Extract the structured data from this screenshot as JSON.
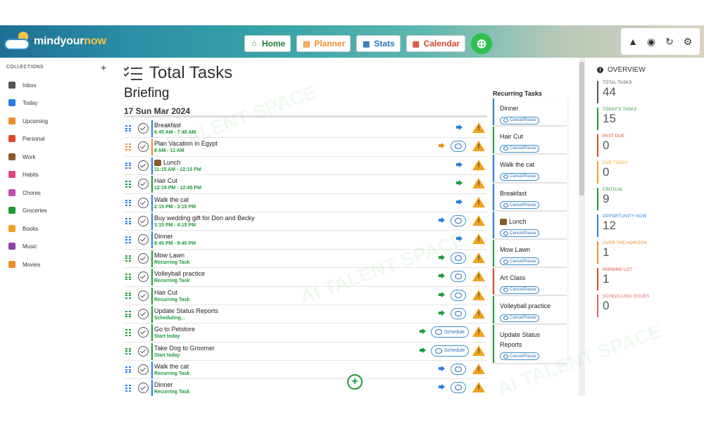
{
  "header": {
    "logo_text_1": "mindyour",
    "logo_text_2": "now",
    "nav": {
      "home": "Home",
      "planner": "Planner",
      "stats": "Stats",
      "calendar": "Calendar"
    }
  },
  "sidebar": {
    "heading": "COLLECTIONS",
    "items": [
      {
        "label": "Inbox",
        "color": "#555555"
      },
      {
        "label": "Today",
        "color": "#2a7de1"
      },
      {
        "label": "Upcoming",
        "color": "#f08c2a"
      },
      {
        "label": "Personal",
        "color": "#d9482b"
      },
      {
        "label": "Work",
        "color": "#8a5a2b"
      },
      {
        "label": "Habits",
        "color": "#e0457b"
      },
      {
        "label": "Chores",
        "color": "#c44bb0"
      },
      {
        "label": "Groceries",
        "color": "#1e9a3a"
      },
      {
        "label": "Books",
        "color": "#f2a11f"
      },
      {
        "label": "Music",
        "color": "#8e44ad"
      },
      {
        "label": "Movies",
        "color": "#f08c2a"
      }
    ]
  },
  "main": {
    "title": "Total Tasks",
    "briefing": "Briefing",
    "date": "17 Sun Mar 2024",
    "tasks": [
      {
        "name": "Breakfast",
        "sub": "6:45 AM - 7:45 AM",
        "grip": "#2a7de1",
        "arrow": "#2a7de1",
        "pill": ""
      },
      {
        "name": "Plan Vacation in Egypt",
        "sub": "8 AM - 11 AM",
        "grip": "#f08c2a",
        "arrow": "#f08c2a",
        "pill": "icon"
      },
      {
        "name": "Lunch",
        "sub": "11:15 AM - 12:15 PM",
        "grip": "#2a7de1",
        "arrow": "#2a7de1",
        "pill": "",
        "emoji": true
      },
      {
        "name": "Hair Cut",
        "sub": "12:15 PM - 12:45 PM",
        "grip": "#1e9a3a",
        "arrow": "#1e9a3a",
        "pill": ""
      },
      {
        "name": "Walk the cat",
        "sub": "2:15 PM - 3:15 PM",
        "grip": "#2a7de1",
        "arrow": "#2a7de1",
        "pill": ""
      },
      {
        "name": "Buy wedding gift for Don and Becky",
        "sub": "3:15 PM - 4:15 PM",
        "grip": "#2a7de1",
        "arrow": "#2a7de1",
        "pill": "icon"
      },
      {
        "name": "Dinner",
        "sub": "8:45 PM - 9:45 PM",
        "grip": "#2a7de1",
        "arrow": "#2a7de1",
        "pill": ""
      },
      {
        "name": "Mow Lawn",
        "sub": "Recurring Task",
        "grip": "#1e9a3a",
        "arrow": "#1e9a3a",
        "pill": "icon"
      },
      {
        "name": "Volleyball practice",
        "sub": "Recurring Task",
        "grip": "#1e9a3a",
        "arrow": "#1e9a3a",
        "pill": "icon"
      },
      {
        "name": "Hair Cut",
        "sub": "Recurring Task",
        "grip": "#1e9a3a",
        "arrow": "#1e9a3a",
        "pill": "icon"
      },
      {
        "name": "Update Status Reports",
        "sub": "Scheduling...",
        "grip": "#1e9a3a",
        "arrow": "#1e9a3a",
        "pill": "icon"
      },
      {
        "name": "Go to Petstore",
        "sub": "Start today",
        "grip": "#1e9a3a",
        "arrow": "#1e9a3a",
        "pill": "Schedule"
      },
      {
        "name": "Take Dog to Groomer",
        "sub": "Start today",
        "grip": "#1e9a3a",
        "arrow": "#1e9a3a",
        "pill": "Schedule"
      },
      {
        "name": "Walk the cat",
        "sub": "Recurring Task",
        "grip": "#2a7de1",
        "arrow": "#2a7de1",
        "pill": "icon"
      },
      {
        "name": "Dinner",
        "sub": "Recurring Task",
        "grip": "#2a7de1",
        "arrow": "#2a7de1",
        "pill": "icon"
      }
    ],
    "recurring_heading": "Recurring Tasks",
    "recurring_button": "Cancel/Pause",
    "recurring": [
      {
        "name": "Dinner",
        "color": "#2a7de1"
      },
      {
        "name": "Hair Cut",
        "color": "#1e9a3a"
      },
      {
        "name": "Walk the cat",
        "color": "#2a7de1"
      },
      {
        "name": "Breakfast",
        "color": "#2a7de1"
      },
      {
        "name": "Lunch",
        "color": "#2a7de1",
        "emoji": true
      },
      {
        "name": "Mow Lawn",
        "color": "#1e9a3a"
      },
      {
        "name": "Art Class",
        "color": "#d9482b"
      },
      {
        "name": "Volleyball practice",
        "color": "#1e9a3a"
      },
      {
        "name": "Update Status Reports",
        "color": "#1e9a3a"
      }
    ]
  },
  "overview": {
    "heading": "OVERVIEW",
    "stats": [
      {
        "label": "TOTAL TASKS",
        "value": "44",
        "color": "#555555"
      },
      {
        "label": "TODAY'S TASKS",
        "value": "15",
        "color": "#1e9a3a"
      },
      {
        "label": "PAST DUE",
        "value": "0",
        "color": "#d9482b"
      },
      {
        "label": "DUE TODAY",
        "value": "0",
        "color": "#f2a11f"
      },
      {
        "label": "CRITICAL",
        "value": "9",
        "color": "#1e9a3a"
      },
      {
        "label": "OPPORTUNITY NOW",
        "value": "12",
        "color": "#2a7de1"
      },
      {
        "label": "OVER THE HORIZON",
        "value": "1",
        "color": "#f08c2a"
      },
      {
        "label": "PARKING LOT",
        "value": "1",
        "color": "#d9482b"
      },
      {
        "label": "SCHEDULING ISSUES",
        "value": "0",
        "color": "#e06060"
      }
    ]
  }
}
